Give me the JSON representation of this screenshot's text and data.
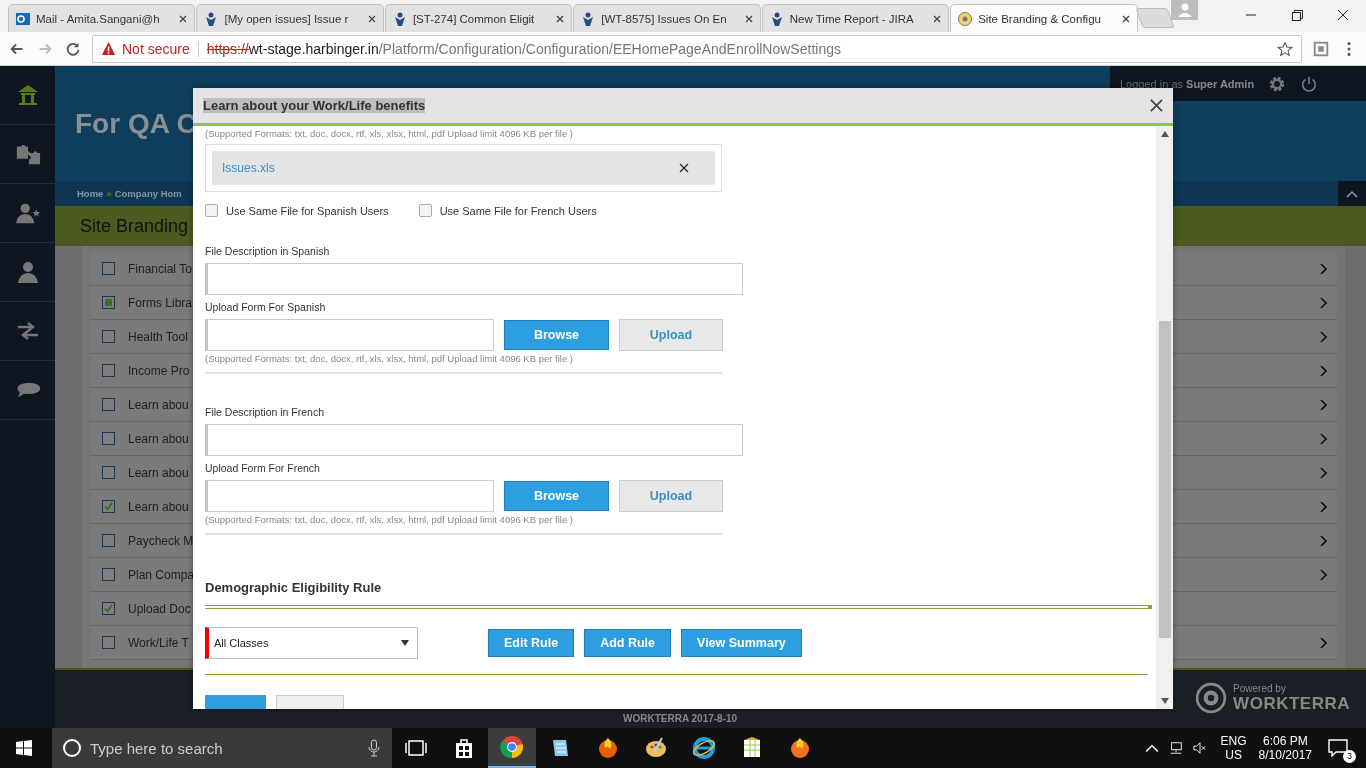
{
  "browser": {
    "tabs": [
      {
        "title": "Mail - Amita.Sangani@h",
        "kind": "mail",
        "selected": false
      },
      {
        "title": "[My open issues] Issue r",
        "kind": "jira",
        "selected": false
      },
      {
        "title": "[ST-274] Common Eligit",
        "kind": "jira",
        "selected": false
      },
      {
        "title": "[WT-8575] Issues On En",
        "kind": "jira",
        "selected": false
      },
      {
        "title": "New Time Report - JIRA",
        "kind": "jira",
        "selected": false
      },
      {
        "title": "Site Branding & Configu",
        "kind": "site",
        "selected": true
      }
    ],
    "address": {
      "warning": "Not secure",
      "scheme": "https://",
      "host": "wt-stage.harbinger.in",
      "path": "/Platform/Configuration/Configuration/EEHomePageAndEnrollNowSettings"
    }
  },
  "header": {
    "title": "For QA C",
    "user_prefix": "Logged in as",
    "user": "Super Admin"
  },
  "sidebar": [
    {
      "kind": "home",
      "selected": true
    },
    {
      "kind": "puzzle",
      "selected": false
    },
    {
      "kind": "person-star",
      "selected": false
    },
    {
      "kind": "person",
      "selected": false
    },
    {
      "kind": "arrows",
      "selected": false
    },
    {
      "kind": "chat",
      "selected": false
    }
  ],
  "breadcrumb": {
    "items": [
      "Home",
      "Company Hom"
    ],
    "separator": "»"
  },
  "page_title": "Site Branding",
  "items": [
    {
      "label": "Financial To",
      "checked": false,
      "partial": false,
      "arrow": true
    },
    {
      "label": "Forms Libra",
      "checked": false,
      "partial": true,
      "arrow": true
    },
    {
      "label": "Health Tool",
      "checked": false,
      "partial": false,
      "arrow": true
    },
    {
      "label": "Income Pro",
      "checked": false,
      "partial": false,
      "arrow": true
    },
    {
      "label": "Learn abou",
      "checked": false,
      "partial": false,
      "arrow": true
    },
    {
      "label": "Learn abou",
      "checked": false,
      "partial": false,
      "arrow": true
    },
    {
      "label": "Learn abou",
      "checked": false,
      "partial": false,
      "arrow": true
    },
    {
      "label": "Learn abou",
      "checked": true,
      "partial": false,
      "arrow": true
    },
    {
      "label": "Paycheck M",
      "checked": false,
      "partial": false,
      "arrow": true
    },
    {
      "label": "Plan Compa",
      "checked": false,
      "partial": false,
      "arrow": true
    },
    {
      "label": "Upload Doc",
      "checked": true,
      "partial": false,
      "arrow": false
    },
    {
      "label": "Work/Life T",
      "checked": false,
      "partial": false,
      "arrow": true
    }
  ],
  "footer": {
    "text": "WORKTERRA 2017-8-10",
    "powered_by": "Powered by",
    "brand": "WORKTERRA"
  },
  "modal": {
    "title": "Learn about your Work/Life benefits",
    "top_note": "(Supported Formats: txt, doc, docx, rtf, xls, xlsx, html, pdf Upload limit 4096 KB per file )",
    "file": "Issues.xls",
    "same_file_options": [
      {
        "label": "Use Same File for Spanish Users",
        "checked": false
      },
      {
        "label": "Use Same File for French Users",
        "checked": false
      }
    ],
    "languages": [
      {
        "description_label": "File Description in Spanish",
        "upload_label": "Upload Form For Spanish",
        "browse": "Browse",
        "upload": "Upload",
        "note": "(Supported Formats: txt, doc, docx, rtf, xls, xlsx, html, pdf Upload limit 4096 KB per file )"
      },
      {
        "description_label": "File Description in French",
        "upload_label": "Upload Form For French",
        "browse": "Browse",
        "upload": "Upload",
        "note": "(Supported Formats: txt, doc, docx, rtf, xls, xlsx, html, pdf Upload limit 4096 KB per file )"
      }
    ],
    "rule": {
      "title": "Demographic Eligibility Rule",
      "select": "All Classes",
      "buttons": [
        "Edit Rule",
        "Add Rule",
        "View Summary"
      ]
    }
  },
  "taskbar": {
    "search_placeholder": "Type here to search",
    "apps": [
      {
        "kind": "taskview",
        "selected": false
      },
      {
        "kind": "store",
        "selected": false
      },
      {
        "kind": "chrome",
        "selected": true
      },
      {
        "kind": "notepad",
        "selected": false
      },
      {
        "kind": "firefox",
        "selected": false
      },
      {
        "kind": "paint",
        "selected": false
      },
      {
        "kind": "ie",
        "selected": false
      },
      {
        "kind": "sheet",
        "selected": false
      },
      {
        "kind": "flame",
        "selected": false
      }
    ],
    "language": [
      "ENG",
      "US"
    ],
    "time": "6:06 PM",
    "date": "8/10/2017",
    "notifications": "3"
  }
}
